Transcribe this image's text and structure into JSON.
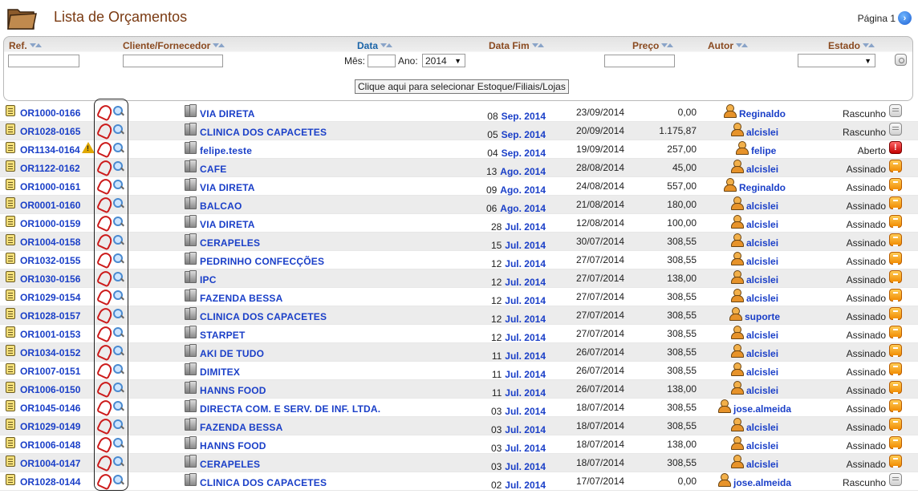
{
  "header": {
    "title": "Lista de Orçamentos",
    "page_label": "Página 1"
  },
  "filters": {
    "columns": {
      "ref": "Ref.",
      "client": "Cliente/Fornecedor",
      "date": "Data",
      "date_end": "Data Fim",
      "price": "Preço",
      "author": "Autor",
      "state": "Estado"
    },
    "month_label": "Mês:",
    "year_label": "Ano:",
    "year_value": "2014",
    "month_value": "",
    "ref_value": "",
    "client_value": "",
    "price_value": "",
    "state_value": "",
    "stock_button": "Clique aqui para selecionar Estoque/Filiais/Lojas"
  },
  "colors": {
    "title": "#7a3a12",
    "link": "#1a3fc8",
    "header_brown": "#8a4a20",
    "header_blue": "#1a64a8",
    "row_alt": "#ececec"
  },
  "rows": [
    {
      "ref": "OR1000-0166",
      "warn": false,
      "client": "VIA DIRETA",
      "day": "08",
      "month": "Sep. 2014",
      "date_end": "23/09/2014",
      "price": "0,00",
      "author": "Reginaldo",
      "state": "Rascunho",
      "state_icon": "grey"
    },
    {
      "ref": "OR1028-0165",
      "warn": false,
      "client": "CLINICA DOS CAPACETES",
      "day": "05",
      "month": "Sep. 2014",
      "date_end": "20/09/2014",
      "price": "1.175,87",
      "author": "alcislei",
      "state": "Rascunho",
      "state_icon": "grey"
    },
    {
      "ref": "OR1134-0164",
      "warn": true,
      "client": "felipe.teste",
      "day": "04",
      "month": "Sep. 2014",
      "date_end": "19/09/2014",
      "price": "257,00",
      "author": "felipe",
      "state": "Aberto",
      "state_icon": "red"
    },
    {
      "ref": "OR1122-0162",
      "warn": false,
      "client": "CAFE",
      "day": "13",
      "month": "Ago. 2014",
      "date_end": "28/08/2014",
      "price": "45,00",
      "author": "alcislei",
      "state": "Assinado",
      "state_icon": "orange"
    },
    {
      "ref": "OR1000-0161",
      "warn": false,
      "client": "VIA DIRETA",
      "day": "09",
      "month": "Ago. 2014",
      "date_end": "24/08/2014",
      "price": "557,00",
      "author": "Reginaldo",
      "state": "Assinado",
      "state_icon": "orange"
    },
    {
      "ref": "OR0001-0160",
      "warn": false,
      "client": "BALCAO",
      "day": "06",
      "month": "Ago. 2014",
      "date_end": "21/08/2014",
      "price": "180,00",
      "author": "alcislei",
      "state": "Assinado",
      "state_icon": "orange"
    },
    {
      "ref": "OR1000-0159",
      "warn": false,
      "client": "VIA DIRETA",
      "day": "28",
      "month": "Jul. 2014",
      "date_end": "12/08/2014",
      "price": "100,00",
      "author": "alcislei",
      "state": "Assinado",
      "state_icon": "orange"
    },
    {
      "ref": "OR1004-0158",
      "warn": false,
      "client": "CERAPELES",
      "day": "15",
      "month": "Jul. 2014",
      "date_end": "30/07/2014",
      "price": "308,55",
      "author": "alcislei",
      "state": "Assinado",
      "state_icon": "orange"
    },
    {
      "ref": "OR1032-0155",
      "warn": false,
      "client": "PEDRINHO CONFECÇÕES",
      "day": "12",
      "month": "Jul. 2014",
      "date_end": "27/07/2014",
      "price": "308,55",
      "author": "alcislei",
      "state": "Assinado",
      "state_icon": "orange"
    },
    {
      "ref": "OR1030-0156",
      "warn": false,
      "client": "IPC",
      "day": "12",
      "month": "Jul. 2014",
      "date_end": "27/07/2014",
      "price": "138,00",
      "author": "alcislei",
      "state": "Assinado",
      "state_icon": "orange"
    },
    {
      "ref": "OR1029-0154",
      "warn": false,
      "client": "FAZENDA BESSA",
      "day": "12",
      "month": "Jul. 2014",
      "date_end": "27/07/2014",
      "price": "308,55",
      "author": "alcislei",
      "state": "Assinado",
      "state_icon": "orange"
    },
    {
      "ref": "OR1028-0157",
      "warn": false,
      "client": "CLINICA DOS CAPACETES",
      "day": "12",
      "month": "Jul. 2014",
      "date_end": "27/07/2014",
      "price": "308,55",
      "author": "suporte",
      "state": "Assinado",
      "state_icon": "orange"
    },
    {
      "ref": "OR1001-0153",
      "warn": false,
      "client": "STARPET",
      "day": "12",
      "month": "Jul. 2014",
      "date_end": "27/07/2014",
      "price": "308,55",
      "author": "alcislei",
      "state": "Assinado",
      "state_icon": "orange"
    },
    {
      "ref": "OR1034-0152",
      "warn": false,
      "client": "AKI DE TUDO",
      "day": "11",
      "month": "Jul. 2014",
      "date_end": "26/07/2014",
      "price": "308,55",
      "author": "alcislei",
      "state": "Assinado",
      "state_icon": "orange"
    },
    {
      "ref": "OR1007-0151",
      "warn": false,
      "client": "DIMITEX",
      "day": "11",
      "month": "Jul. 2014",
      "date_end": "26/07/2014",
      "price": "308,55",
      "author": "alcislei",
      "state": "Assinado",
      "state_icon": "orange"
    },
    {
      "ref": "OR1006-0150",
      "warn": false,
      "client": "HANNS FOOD",
      "day": "11",
      "month": "Jul. 2014",
      "date_end": "26/07/2014",
      "price": "138,00",
      "author": "alcislei",
      "state": "Assinado",
      "state_icon": "orange"
    },
    {
      "ref": "OR1045-0146",
      "warn": false,
      "client": "DIRECTA COM. E SERV. DE INF. LTDA.",
      "day": "03",
      "month": "Jul. 2014",
      "date_end": "18/07/2014",
      "price": "308,55",
      "author": "jose.almeida",
      "state": "Assinado",
      "state_icon": "orange"
    },
    {
      "ref": "OR1029-0149",
      "warn": false,
      "client": "FAZENDA BESSA",
      "day": "03",
      "month": "Jul. 2014",
      "date_end": "18/07/2014",
      "price": "308,55",
      "author": "alcislei",
      "state": "Assinado",
      "state_icon": "orange"
    },
    {
      "ref": "OR1006-0148",
      "warn": false,
      "client": "HANNS FOOD",
      "day": "03",
      "month": "Jul. 2014",
      "date_end": "18/07/2014",
      "price": "138,00",
      "author": "alcislei",
      "state": "Assinado",
      "state_icon": "orange"
    },
    {
      "ref": "OR1004-0147",
      "warn": false,
      "client": "CERAPELES",
      "day": "03",
      "month": "Jul. 2014",
      "date_end": "18/07/2014",
      "price": "308,55",
      "author": "alcislei",
      "state": "Assinado",
      "state_icon": "orange"
    },
    {
      "ref": "OR1028-0144",
      "warn": false,
      "client": "CLINICA DOS CAPACETES",
      "day": "02",
      "month": "Jul. 2014",
      "date_end": "17/07/2014",
      "price": "0,00",
      "author": "jose.almeida",
      "state": "Rascunho",
      "state_icon": "grey"
    }
  ]
}
